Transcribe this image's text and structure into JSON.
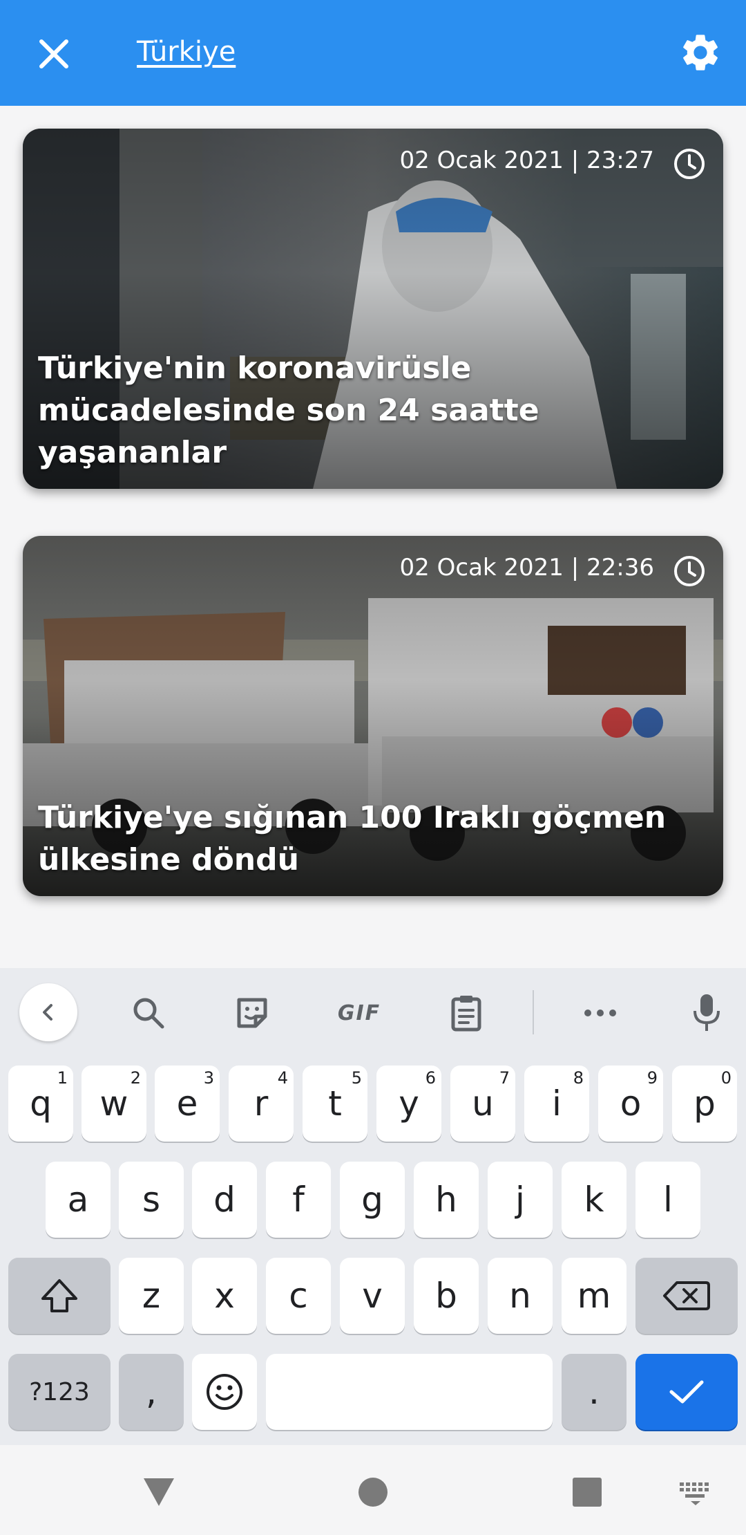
{
  "header": {
    "title": "Türkiye",
    "close_icon": "close-icon",
    "settings_icon": "gear-icon",
    "bg_color": "#2b8ff0"
  },
  "news": [
    {
      "date": "02 Ocak 2021 | 23:27",
      "headline": "Türkiye'nin koronavirüsle mücadelesinde son 24 saatte yaşananlar"
    },
    {
      "date": "02 Ocak 2021 | 22:36",
      "headline": "Türkiye'ye sığınan 100 Iraklı göçmen ülkesine döndü"
    }
  ],
  "keyboard": {
    "toolbar": {
      "back_icon": "chevron-left-icon",
      "search_icon": "search-icon",
      "sticker_icon": "sticker-icon",
      "gif_label": "GIF",
      "clipboard_icon": "clipboard-icon",
      "more_icon": "more-horizontal-icon",
      "mic_icon": "microphone-icon"
    },
    "row1": [
      {
        "key": "q",
        "hint": "1"
      },
      {
        "key": "w",
        "hint": "2"
      },
      {
        "key": "e",
        "hint": "3"
      },
      {
        "key": "r",
        "hint": "4"
      },
      {
        "key": "t",
        "hint": "5"
      },
      {
        "key": "y",
        "hint": "6"
      },
      {
        "key": "u",
        "hint": "7"
      },
      {
        "key": "i",
        "hint": "8"
      },
      {
        "key": "o",
        "hint": "9"
      },
      {
        "key": "p",
        "hint": "0"
      }
    ],
    "row2": [
      "a",
      "s",
      "d",
      "f",
      "g",
      "h",
      "j",
      "k",
      "l"
    ],
    "row3": [
      "z",
      "x",
      "c",
      "v",
      "b",
      "n",
      "m"
    ],
    "symbols_label": "?123",
    "comma_label": ",",
    "period_label": ".",
    "accent_color": "#1a73e8"
  }
}
